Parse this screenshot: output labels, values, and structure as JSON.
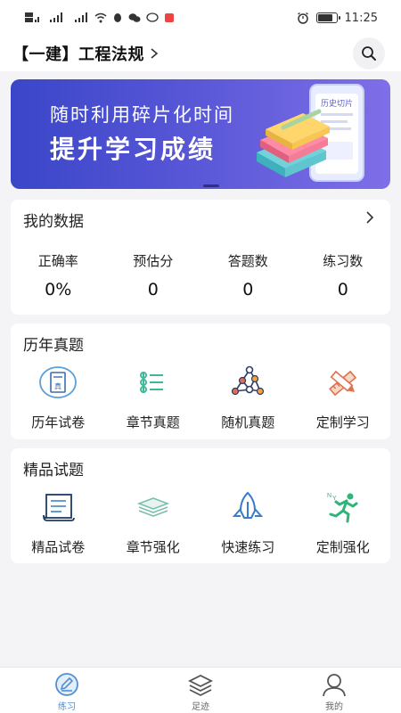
{
  "status_bar": {
    "left_text": "HD 4G 4G",
    "time": "11:25",
    "battery_level": 0.8
  },
  "header": {
    "title": "【一建】工程法规",
    "search_icon": "search-icon",
    "chevron_icon": "chevron-right-icon"
  },
  "banner": {
    "line1": "随时利用碎片化时间",
    "line2": "提升学习成绩",
    "phone_label": "历史切片",
    "colors": {
      "start": "#3a46c8",
      "end": "#7f6fe8"
    }
  },
  "my_data": {
    "title": "我的数据",
    "stats": [
      {
        "label": "正确率",
        "value": "0%"
      },
      {
        "label": "预估分",
        "value": "0"
      },
      {
        "label": "答题数",
        "value": "0"
      },
      {
        "label": "练习数",
        "value": "0"
      }
    ]
  },
  "past_exams": {
    "title": "历年真题",
    "items": [
      {
        "label": "历年试卷",
        "icon": "exam-paper-icon"
      },
      {
        "label": "章节真题",
        "icon": "chapter-list-icon"
      },
      {
        "label": "随机真题",
        "icon": "random-network-icon"
      },
      {
        "label": "定制学习",
        "icon": "pencil-ruler-icon"
      }
    ]
  },
  "premium": {
    "title": "精品试题",
    "items": [
      {
        "label": "精品试卷",
        "icon": "scroll-icon"
      },
      {
        "label": "章节强化",
        "icon": "stack-icon"
      },
      {
        "label": "快速练习",
        "icon": "rocket-icon"
      },
      {
        "label": "定制强化",
        "icon": "runner-icon"
      }
    ]
  },
  "tabbar": {
    "tabs": [
      {
        "label": "练习",
        "icon": "pencil-circle-icon",
        "active": true
      },
      {
        "label": "足迹",
        "icon": "layers-icon",
        "active": false
      },
      {
        "label": "我的",
        "icon": "user-icon",
        "active": false
      }
    ],
    "active_color": "#4f8fd6"
  }
}
